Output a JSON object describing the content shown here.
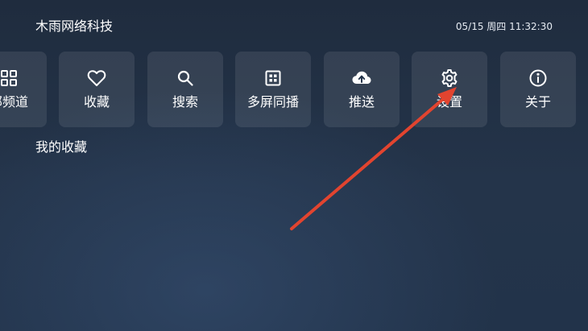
{
  "header": {
    "app_title": "木雨网络科技",
    "datetime": "05/15 周四 11:32:30"
  },
  "tiles": [
    {
      "id": "all-channels",
      "label": "部频道",
      "icon": "grid-icon"
    },
    {
      "id": "favorites",
      "label": "收藏",
      "icon": "heart-icon"
    },
    {
      "id": "search",
      "label": "搜索",
      "icon": "search-icon"
    },
    {
      "id": "multi-screen",
      "label": "多屏同播",
      "icon": "screen-grid-icon"
    },
    {
      "id": "push",
      "label": "推送",
      "icon": "cloud-upload-icon"
    },
    {
      "id": "settings",
      "label": "设置",
      "icon": "gear-icon"
    },
    {
      "id": "about",
      "label": "关于",
      "icon": "info-icon"
    }
  ],
  "main": {
    "section_title": "我的收藏"
  },
  "colors": {
    "background_top": "#1f2c3e",
    "tile_fill": "rgba(255,255,255,0.09)",
    "annotation_arrow": "#e2442f"
  }
}
